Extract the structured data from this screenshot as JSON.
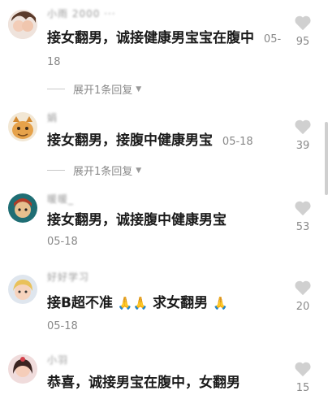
{
  "comments": [
    {
      "username": "小雨 2000 ···",
      "text": "接女翻男，诚接健康男宝宝在腹中",
      "date": "05-18",
      "replies": "展开1条回复",
      "likes": "95"
    },
    {
      "username": "娟",
      "text": "接女翻男，接腹中健康男宝",
      "date": "05-18",
      "replies": "展开1条回复",
      "likes": "39"
    },
    {
      "username": "暖暖_",
      "text": "接女翻男，诚接腹中健康男宝",
      "date": "05-18",
      "likes": "53"
    },
    {
      "username": "好好学习",
      "text_a": "接B超不准",
      "text_b": "求女翻男",
      "date": "05-18",
      "likes": "20"
    },
    {
      "username": "小羽",
      "text": "恭喜，诚接男宝在腹中，女翻男",
      "likes": "15"
    }
  ],
  "icons": {
    "like": "heart-icon",
    "expand": "caret-down-icon",
    "emoji": "folded-hands-emoji"
  },
  "colors": {
    "heart": "#cfcfcf",
    "muted_text": "#8a8a8a"
  }
}
